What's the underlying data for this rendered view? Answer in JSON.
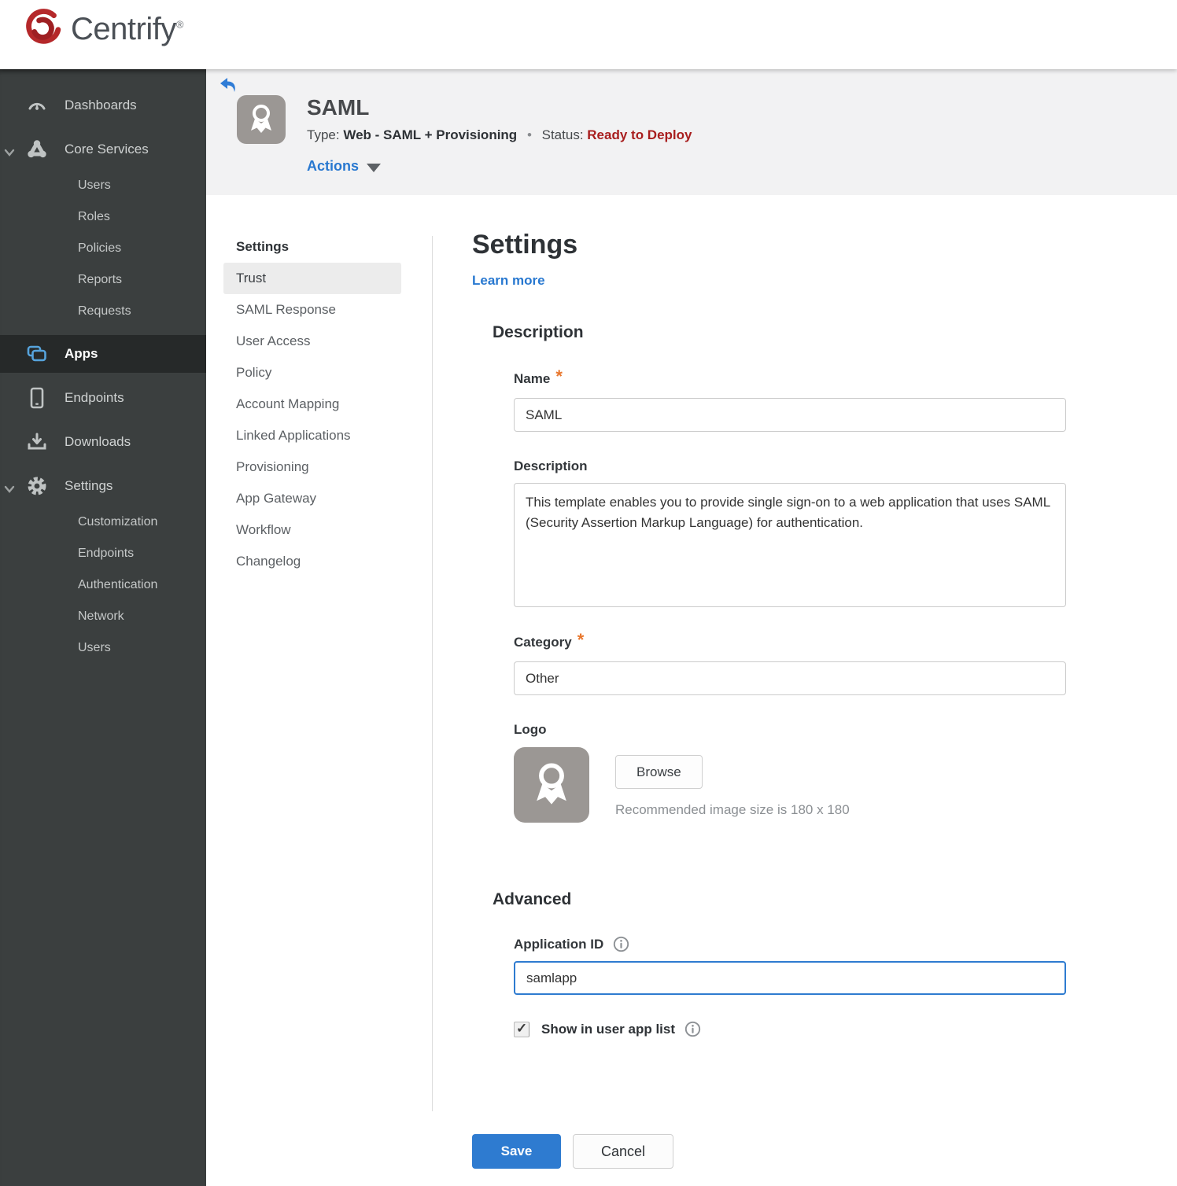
{
  "brand": {
    "name": "Centrify",
    "trademark": "®",
    "logo_color": "#b5282a"
  },
  "sidebar": {
    "items": [
      {
        "label": "Dashboards",
        "icon": "gauge-icon"
      },
      {
        "label": "Core Services",
        "icon": "cluster-icon",
        "expanded": true,
        "children": [
          "Users",
          "Roles",
          "Policies",
          "Reports",
          "Requests"
        ]
      },
      {
        "label": "Apps",
        "icon": "apps-icon",
        "active": true,
        "active_icon_color": "#56a3dc"
      },
      {
        "label": "Endpoints",
        "icon": "phone-icon"
      },
      {
        "label": "Downloads",
        "icon": "download-icon"
      },
      {
        "label": "Settings",
        "icon": "gear-icon",
        "expanded": true,
        "children": [
          "Customization",
          "Endpoints",
          "Authentication",
          "Network",
          "Users"
        ]
      }
    ]
  },
  "app_header": {
    "title": "SAML",
    "type_label": "Type:",
    "type_value": "Web - SAML + Provisioning",
    "separator": "•",
    "status_label": "Status:",
    "status_value": "Ready to Deploy",
    "status_color": "#a81e1e",
    "actions_label": "Actions"
  },
  "subnav": {
    "header": "Settings",
    "selected": "Trust",
    "items": [
      "Trust",
      "SAML Response",
      "User Access",
      "Policy",
      "Account Mapping",
      "Linked Applications",
      "Provisioning",
      "App Gateway",
      "Workflow",
      "Changelog"
    ]
  },
  "main": {
    "title": "Settings",
    "learn_more_label": "Learn more",
    "required_marker": "*",
    "description_section": {
      "heading": "Description",
      "name_label": "Name",
      "name_value": "SAML",
      "description_label": "Description",
      "description_value": "This template enables you to provide single sign-on to a web application that uses SAML (Security Assertion Markup Language) for authentication.",
      "category_label": "Category",
      "category_value": "Other",
      "logo_label": "Logo",
      "browse_label": "Browse",
      "logo_hint": "Recommended image size is 180 x 180"
    },
    "advanced_section": {
      "heading": "Advanced",
      "application_id_label": "Application ID",
      "application_id_value": "samlapp",
      "show_in_user_app_list_label": "Show in user app list",
      "checkbox_checked": true
    },
    "footer": {
      "save_label": "Save",
      "cancel_label": "Cancel"
    }
  },
  "colors": {
    "accent_blue": "#2e7bd0",
    "link_blue": "#2878d0",
    "status_red": "#a81e1e",
    "required_orange": "#e8762c",
    "sidebar_bg": "#3b3f3f",
    "sidebar_active_bg": "#262929",
    "header_band_bg": "#f2f2f3"
  }
}
